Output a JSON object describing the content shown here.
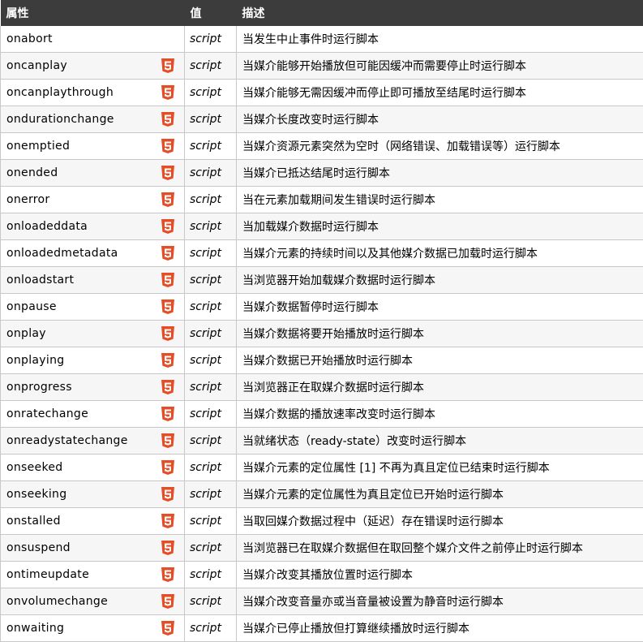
{
  "table": {
    "headers": [
      "属性",
      "值",
      "描述"
    ],
    "accent_color": "#e44d26",
    "rows": [
      {
        "attr": "onabort",
        "html5": false,
        "value": "script",
        "desc": "当发生中止事件时运行脚本"
      },
      {
        "attr": "oncanplay",
        "html5": true,
        "value": "script",
        "desc": "当媒介能够开始播放但可能因缓冲而需要停止时运行脚本"
      },
      {
        "attr": "oncanplaythrough",
        "html5": true,
        "value": "script",
        "desc": "当媒介能够无需因缓冲而停止即可播放至结尾时运行脚本"
      },
      {
        "attr": "ondurationchange",
        "html5": true,
        "value": "script",
        "desc": "当媒介长度改变时运行脚本"
      },
      {
        "attr": "onemptied",
        "html5": true,
        "value": "script",
        "desc": "当媒介资源元素突然为空时（网络错误、加载错误等）运行脚本"
      },
      {
        "attr": "onended",
        "html5": true,
        "value": "script",
        "desc": "当媒介已抵达结尾时运行脚本"
      },
      {
        "attr": "onerror",
        "html5": true,
        "value": "script",
        "desc": "当在元素加载期间发生错误时运行脚本"
      },
      {
        "attr": "onloadeddata",
        "html5": true,
        "value": "script",
        "desc": "当加载媒介数据时运行脚本"
      },
      {
        "attr": "onloadedmetadata",
        "html5": true,
        "value": "script",
        "desc": "当媒介元素的持续时间以及其他媒介数据已加载时运行脚本"
      },
      {
        "attr": "onloadstart",
        "html5": true,
        "value": "script",
        "desc": "当浏览器开始加载媒介数据时运行脚本"
      },
      {
        "attr": "onpause",
        "html5": true,
        "value": "script",
        "desc": "当媒介数据暂停时运行脚本"
      },
      {
        "attr": "onplay",
        "html5": true,
        "value": "script",
        "desc": "当媒介数据将要开始播放时运行脚本"
      },
      {
        "attr": "onplaying",
        "html5": true,
        "value": "script",
        "desc": "当媒介数据已开始播放时运行脚本"
      },
      {
        "attr": "onprogress",
        "html5": true,
        "value": "script",
        "desc": "当浏览器正在取媒介数据时运行脚本"
      },
      {
        "attr": "onratechange",
        "html5": true,
        "value": "script",
        "desc": "当媒介数据的播放速率改变时运行脚本"
      },
      {
        "attr": "onreadystatechange",
        "html5": true,
        "value": "script",
        "desc": "当就绪状态（ready-state）改变时运行脚本"
      },
      {
        "attr": "onseeked",
        "html5": true,
        "value": "script",
        "desc": "当媒介元素的定位属性 [1] 不再为真且定位已结束时运行脚本"
      },
      {
        "attr": "onseeking",
        "html5": true,
        "value": "script",
        "desc": "当媒介元素的定位属性为真且定位已开始时运行脚本"
      },
      {
        "attr": "onstalled",
        "html5": true,
        "value": "script",
        "desc": "当取回媒介数据过程中（延迟）存在错误时运行脚本"
      },
      {
        "attr": "onsuspend",
        "html5": true,
        "value": "script",
        "desc": "当浏览器已在取媒介数据但在取回整个媒介文件之前停止时运行脚本"
      },
      {
        "attr": "ontimeupdate",
        "html5": true,
        "value": "script",
        "desc": "当媒介改变其播放位置时运行脚本"
      },
      {
        "attr": "onvolumechange",
        "html5": true,
        "value": "script",
        "desc": "当媒介改变音量亦或当音量被设置为静音时运行脚本"
      },
      {
        "attr": "onwaiting",
        "html5": true,
        "value": "script",
        "desc": "当媒介已停止播放但打算继续播放时运行脚本"
      }
    ]
  }
}
